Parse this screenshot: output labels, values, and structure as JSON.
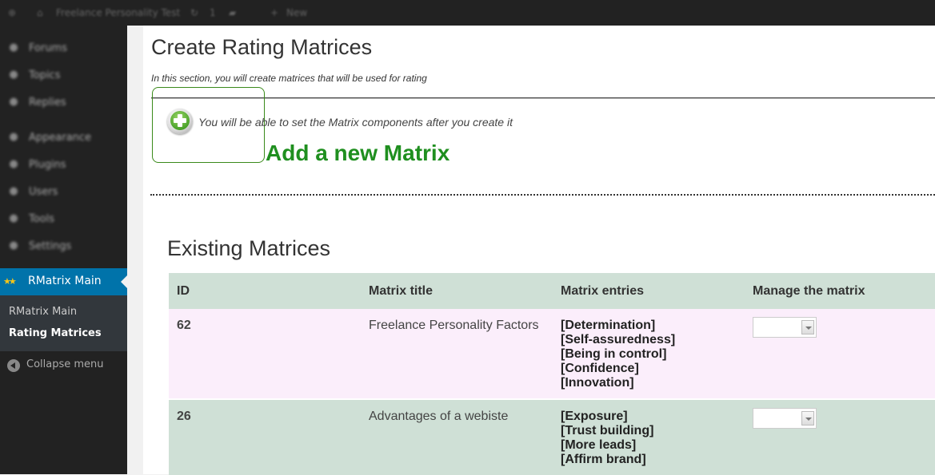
{
  "adminbar": {
    "site_name": "Freelance Personality Test",
    "comment_count": "1",
    "new_label": "New"
  },
  "sidebar": {
    "items": [
      {
        "label": "Forums",
        "icon": "forum-icon"
      },
      {
        "label": "Topics",
        "icon": "topic-icon"
      },
      {
        "label": "Replies",
        "icon": "reply-icon"
      },
      {
        "label": "Appearance",
        "icon": "brush-icon"
      },
      {
        "label": "Plugins",
        "icon": "plugin-icon"
      },
      {
        "label": "Users",
        "icon": "users-icon"
      },
      {
        "label": "Tools",
        "icon": "tools-icon"
      },
      {
        "label": "Settings",
        "icon": "settings-icon"
      }
    ],
    "active_menu": "RMatrix Main",
    "submenu": [
      "RMatrix Main",
      "Rating Matrices"
    ],
    "current_submenu": "Rating Matrices",
    "collapse_label": "Collapse menu"
  },
  "page": {
    "title": "Create Rating Matrices",
    "intro": "In this section, you will create matrices that will be used for rating",
    "add_hint": "You will be able to set the Matrix components after you create it",
    "add_label": "Add a new Matrix",
    "existing_title": "Existing Matrices"
  },
  "table": {
    "headers": [
      "ID",
      "Matrix title",
      "Matrix entries",
      "Manage the matrix"
    ],
    "rows": [
      {
        "id": "62",
        "title": "Freelance Personality Factors",
        "entries": [
          "[Determination]",
          "[Self-assuredness]",
          "[Being in control]",
          "[Confidence]",
          "[Innovation]"
        ],
        "manage_value": ""
      },
      {
        "id": "26",
        "title": "Advantages of a webiste",
        "entries": [
          "[Exposure]",
          "[Trust building]",
          "[More leads]",
          "[Affirm brand]"
        ],
        "manage_value": ""
      }
    ]
  },
  "colors": {
    "active_menu_bg": "#0073aa",
    "header_row_bg": "#cfe0d6",
    "row_pink_bg": "#fbeefb",
    "add_label_green": "#1f8f1f"
  }
}
